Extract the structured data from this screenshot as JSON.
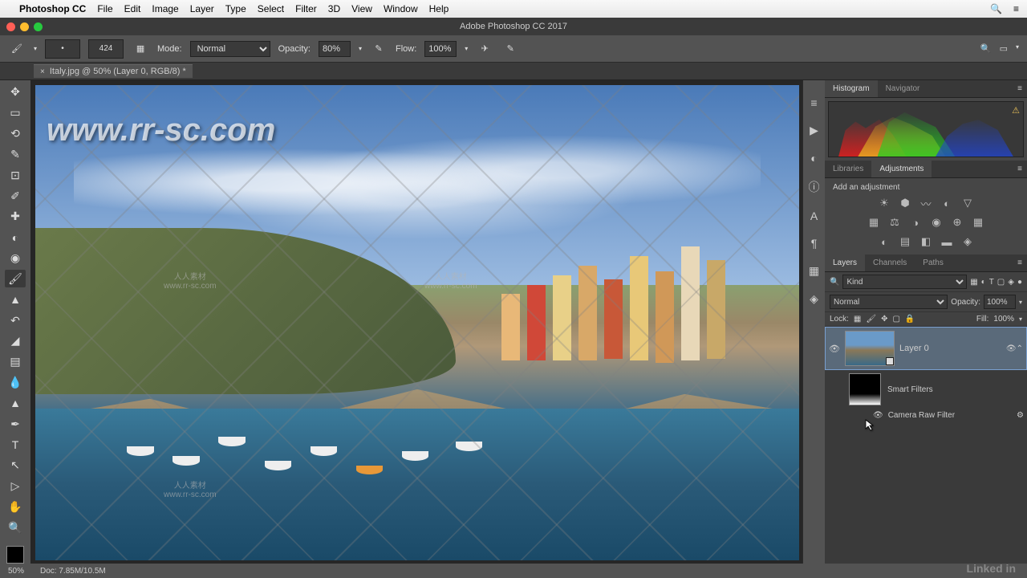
{
  "menubar": {
    "app": "Photoshop CC",
    "items": [
      "File",
      "Edit",
      "Image",
      "Layer",
      "Type",
      "Select",
      "Filter",
      "3D",
      "View",
      "Window",
      "Help"
    ]
  },
  "window_title": "Adobe Photoshop CC 2017",
  "optbar": {
    "brush_size": "424",
    "mode_label": "Mode:",
    "mode_value": "Normal",
    "opacity_label": "Opacity:",
    "opacity_value": "80%",
    "flow_label": "Flow:",
    "flow_value": "100%"
  },
  "doc_tab": "Italy.jpg @ 50% (Layer 0, RGB/8) *",
  "panels": {
    "histogram_tab": "Histogram",
    "navigator_tab": "Navigator",
    "libraries_tab": "Libraries",
    "adjustments_tab": "Adjustments",
    "add_adjustment": "Add an adjustment",
    "layers_tab": "Layers",
    "channels_tab": "Channels",
    "paths_tab": "Paths",
    "kind_filter": "Kind",
    "blend_mode": "Normal",
    "opacity_label": "Opacity:",
    "opacity_value": "100%",
    "lock_label": "Lock:",
    "fill_label": "Fill:",
    "fill_value": "100%",
    "layer0_name": "Layer 0",
    "smart_filters_label": "Smart Filters",
    "camera_raw": "Camera Raw Filter"
  },
  "statusbar": {
    "zoom": "50%",
    "doc_info": "Doc: 7.85M/10.5M"
  },
  "watermark": {
    "big": "www.rr-sc.com",
    "small_cn": "人人素材",
    "small_url": "www.rr-sc.com",
    "linkedin": "Linked in"
  }
}
